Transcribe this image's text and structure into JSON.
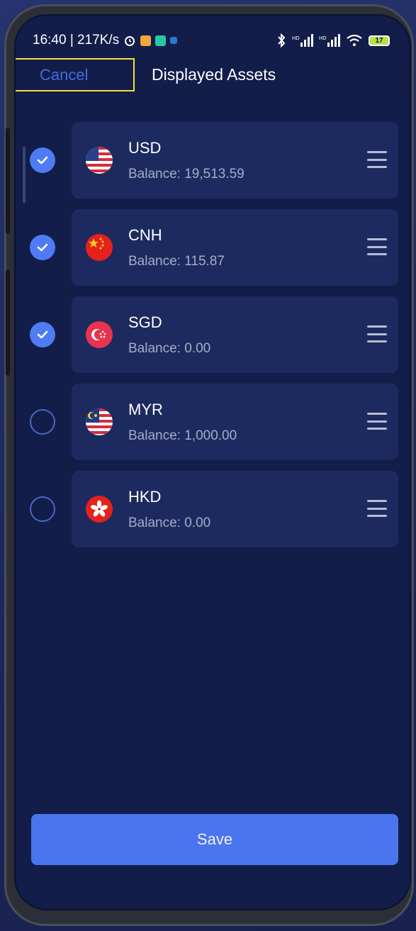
{
  "status_bar": {
    "time_speed": "16:40 | 217K/s",
    "battery": "17"
  },
  "header": {
    "cancel_label": "Cancel",
    "title": "Displayed Assets"
  },
  "assets": [
    {
      "code": "USD",
      "balance": "Balance: 19,513.59",
      "checked": true,
      "flag": "us-flag-icon"
    },
    {
      "code": "CNH",
      "balance": "Balance: 115.87",
      "checked": true,
      "flag": "cn-flag-icon"
    },
    {
      "code": "SGD",
      "balance": "Balance: 0.00",
      "checked": true,
      "flag": "sg-flag-icon"
    },
    {
      "code": "MYR",
      "balance": "Balance: 1,000.00",
      "checked": false,
      "flag": "my-flag-icon"
    },
    {
      "code": "HKD",
      "balance": "Balance: 0.00",
      "checked": false,
      "flag": "hk-flag-icon"
    }
  ],
  "save_label": "Save",
  "colors": {
    "accent": "#4a75ef",
    "background": "#121d49",
    "card": "#1d2a5f",
    "highlight_border": "#f1e33a"
  }
}
